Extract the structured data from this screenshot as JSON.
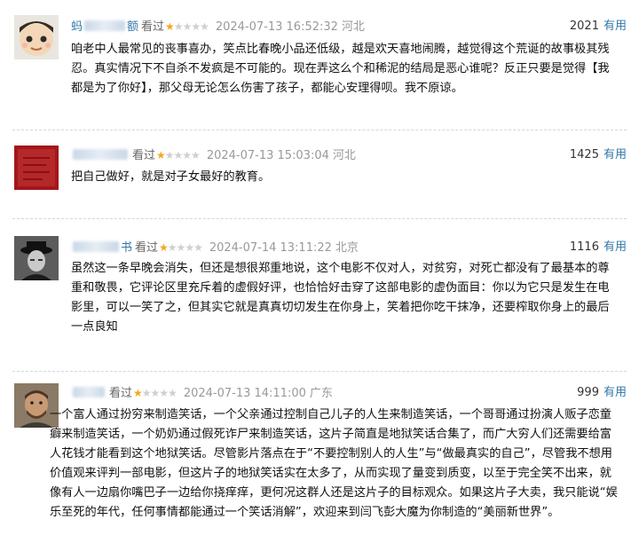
{
  "reviews": [
    {
      "user_prefix": "蚂",
      "user_suffix": "额",
      "action": "看过",
      "rating": 1,
      "time": "2024-07-13 16:52:32",
      "location": "河北",
      "votes": "2021",
      "vote_label": "有用",
      "text": "咱老中人最常见的丧事喜办，笑点比春晚小品还低级，越是欢天喜地闹腾，越觉得这个荒诞的故事极其残忍。真实情况下不自杀不发疯是不可能的。现在弄这么个和稀泥的结局是恶心谁呢？反正只要是觉得【我都是为了你好】，那父母无论怎么伤害了孩子，都能心安理得呗。我不原谅。"
    },
    {
      "user_prefix": "",
      "user_suffix": "",
      "action": "看过",
      "rating": 1,
      "time": "2024-07-13 15:03:04",
      "location": "河北",
      "votes": "1425",
      "vote_label": "有用",
      "text": "把自己做好，就是对子女最好的教育。"
    },
    {
      "user_prefix": "",
      "user_suffix": "书",
      "action": "看过",
      "rating": 1,
      "time": "2024-07-14 13:11:22",
      "location": "北京",
      "votes": "1116",
      "vote_label": "有用",
      "text": "虽然这一条早晚会消失，但还是想很郑重地说，这个电影不仅对人，对贫穷，对死亡都没有了最基本的尊重和敬畏，它评论区里充斥着的虚假好评，也恰恰好击穿了这部电影的虚伪面目：你以为它只是发生在电影里，可以一笑了之，但其实它就是真真切切发生在你身上，笑着把你吃干抹净，还要榨取你身上的最后一点良知"
    },
    {
      "user_prefix": "",
      "user_suffix": "",
      "action": "看过",
      "rating": 1,
      "time": "2024-07-13 14:11:00",
      "location": "广东",
      "votes": "999",
      "vote_label": "有用",
      "text": "一个富人通过扮穷来制造笑话，一个父亲通过控制自己儿子的人生来制造笑话，一个哥哥通过扮演人贩子恋童癖来制造笑话，一个奶奶通过假死诈尸来制造笑话，这片子简直是地狱笑话合集了，而广大穷人们还需要给富人花钱才能看到这个地狱笑话。尽管影片落点在于“不要控制别人的人生”与“做最真实的自己”，尽管我不想用价值观来评判一部电影，但这片子的地狱笑话实在太多了，从而实现了量变到质变，以至于完全笑不出来，就像有人一边扇你嘴巴子一边给你挠痒痒，更何况这群人还是这片子的目标观众。如果这片子大卖，我只能说“娱乐至死的年代，任何事情都能通过一个笑话消解”，欢迎来到闫飞彭大魔为你制造的“美丽新世界”。"
    }
  ]
}
